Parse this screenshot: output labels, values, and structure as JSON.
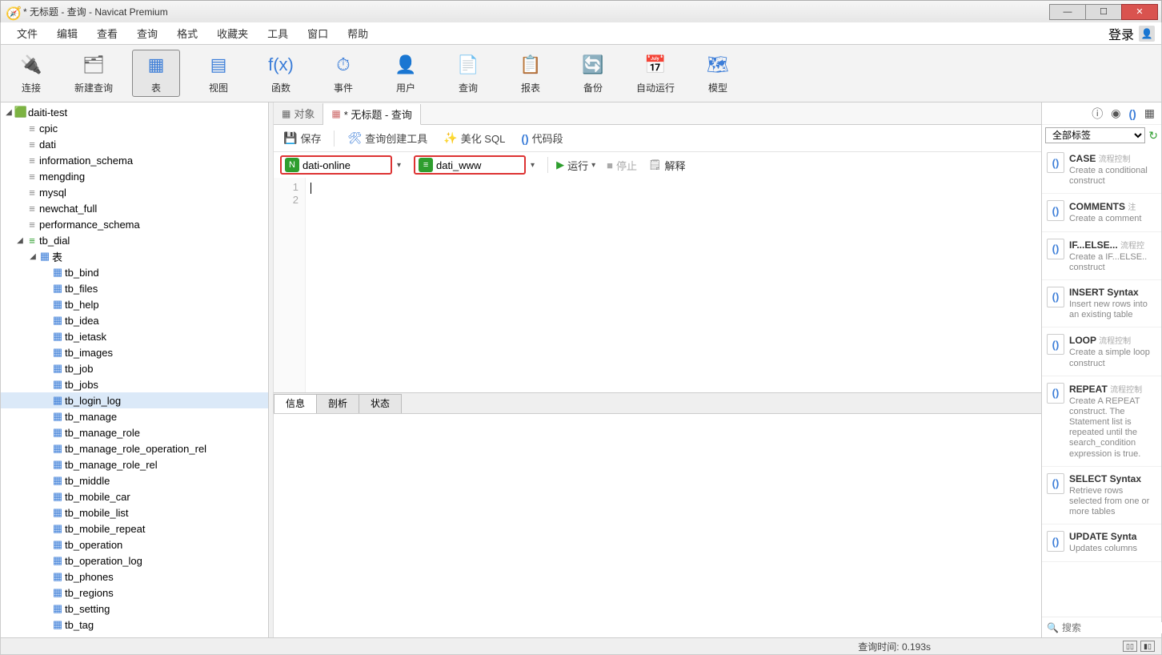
{
  "title": "* 无标题 - 查询 - Navicat Premium",
  "menus": [
    "文件",
    "编辑",
    "查看",
    "查询",
    "格式",
    "收藏夹",
    "工具",
    "窗口",
    "帮助"
  ],
  "login_label": "登录",
  "toolbar": [
    {
      "label": "连接",
      "icon": "🔌"
    },
    {
      "label": "新建查询",
      "icon": "🗂"
    },
    {
      "label": "表",
      "icon": "▦",
      "active": true
    },
    {
      "label": "视图",
      "icon": "▤"
    },
    {
      "label": "函数",
      "icon": "f(x)"
    },
    {
      "label": "事件",
      "icon": "⏱"
    },
    {
      "label": "用户",
      "icon": "👤"
    },
    {
      "label": "查询",
      "icon": "📄"
    },
    {
      "label": "报表",
      "icon": "📋"
    },
    {
      "label": "备份",
      "icon": "🔄"
    },
    {
      "label": "自动运行",
      "icon": "📅"
    },
    {
      "label": "模型",
      "icon": "🗺"
    }
  ],
  "tree": {
    "connection": "daiti-test",
    "databases": [
      "cpic",
      "dati",
      "information_schema",
      "mengding",
      "mysql",
      "newchat_full",
      "performance_schema"
    ],
    "active_db": "tb_dial",
    "tables_label": "表",
    "tables": [
      "tb_bind",
      "tb_files",
      "tb_help",
      "tb_idea",
      "tb_ietask",
      "tb_images",
      "tb_job",
      "tb_jobs",
      "tb_login_log",
      "tb_manage",
      "tb_manage_role",
      "tb_manage_role_operation_rel",
      "tb_manage_role_rel",
      "tb_middle",
      "tb_mobile_car",
      "tb_mobile_list",
      "tb_mobile_repeat",
      "tb_operation",
      "tb_operation_log",
      "tb_phones",
      "tb_regions",
      "tb_setting",
      "tb_tag"
    ],
    "selected_table": "tb_login_log"
  },
  "center_tabs": {
    "objects": "对象",
    "query_tab": "* 无标题 - 查询"
  },
  "query_toolbar": {
    "save": "保存",
    "builder": "查询创建工具",
    "beautify": "美化 SQL",
    "snippet": "代码段"
  },
  "selectors": {
    "connection": "dati-online",
    "database": "dati_www"
  },
  "run_controls": {
    "run": "运行",
    "stop": "停止",
    "explain": "解释"
  },
  "editor": {
    "lines": [
      "1",
      "2"
    ]
  },
  "result_tabs": [
    "信息",
    "剖析",
    "状态"
  ],
  "right_panel": {
    "tag_filter": "全部标签",
    "search_placeholder": "搜索",
    "snippets": [
      {
        "title": "CASE",
        "tag": "流程控制",
        "desc": "Create a conditional construct"
      },
      {
        "title": "COMMENTS",
        "tag": "注",
        "desc": "Create a comment"
      },
      {
        "title": "IF...ELSE...",
        "tag": "流程控",
        "desc": "Create a IF...ELSE.. construct"
      },
      {
        "title": "INSERT Syntax",
        "tag": "",
        "desc": "Insert new rows into an existing table"
      },
      {
        "title": "LOOP",
        "tag": "流程控制",
        "desc": "Create a simple loop construct"
      },
      {
        "title": "REPEAT",
        "tag": "流程控制",
        "desc": "Create A REPEAT construct. The Statement list is repeated until the search_condition expression is true."
      },
      {
        "title": "SELECT Syntax",
        "tag": "",
        "desc": "Retrieve rows selected from one or more tables"
      },
      {
        "title": "UPDATE Synta",
        "tag": "",
        "desc": "Updates columns"
      }
    ]
  },
  "statusbar": {
    "query_time": "查询时间: 0.193s"
  }
}
